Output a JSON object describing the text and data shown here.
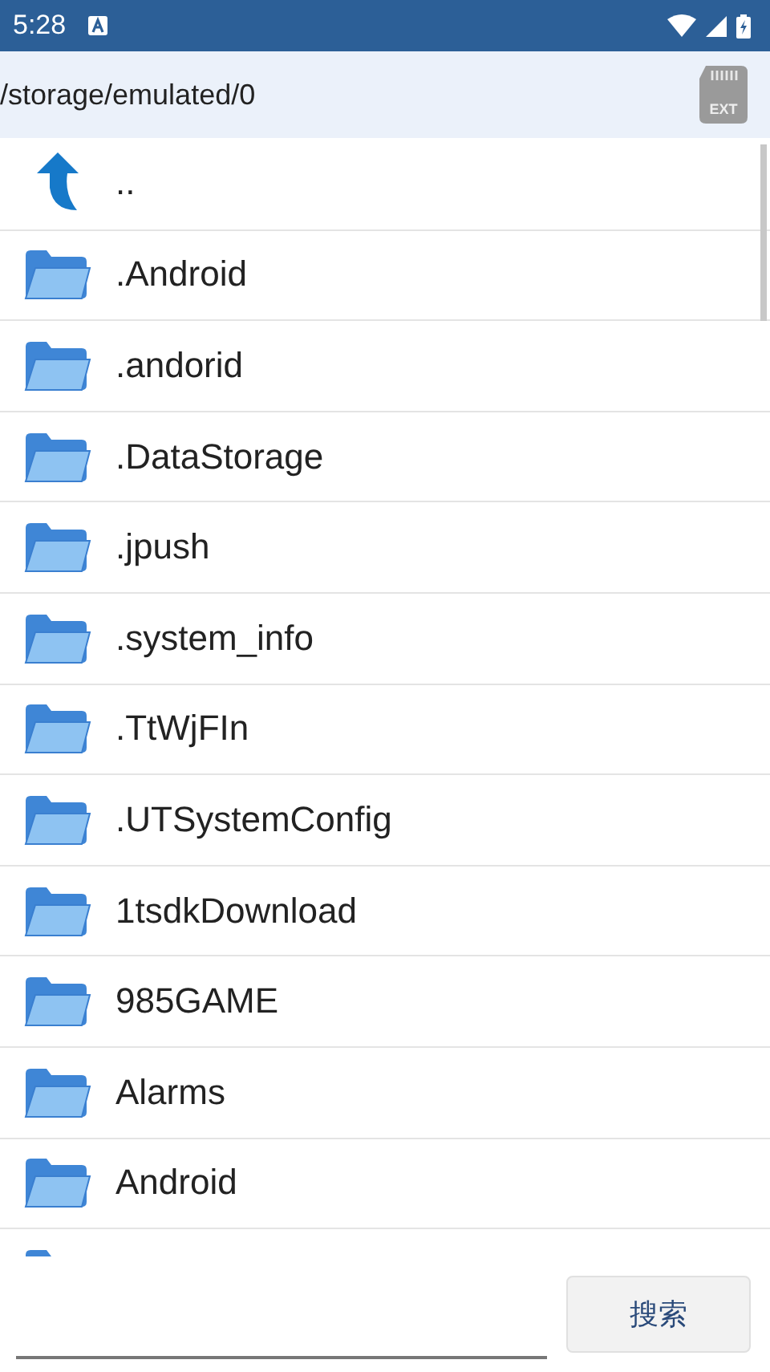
{
  "status_bar": {
    "time": "5:28"
  },
  "path_bar": {
    "path": "/storage/emulated/0",
    "storage_label": "EXT"
  },
  "files": [
    {
      "kind": "parent",
      "name": ".."
    },
    {
      "kind": "folder",
      "name": ".Android"
    },
    {
      "kind": "folder",
      "name": ".andorid"
    },
    {
      "kind": "folder",
      "name": ".DataStorage"
    },
    {
      "kind": "folder",
      "name": ".jpush"
    },
    {
      "kind": "folder",
      "name": ".system_info"
    },
    {
      "kind": "folder",
      "name": ".TtWjFIn"
    },
    {
      "kind": "folder",
      "name": ".UTSystemConfig"
    },
    {
      "kind": "folder",
      "name": "1tsdkDownload"
    },
    {
      "kind": "folder",
      "name": "985GAME"
    },
    {
      "kind": "folder",
      "name": "Alarms"
    },
    {
      "kind": "folder",
      "name": "Android"
    },
    {
      "kind": "folder"
    }
  ],
  "search": {
    "button": "搜索"
  }
}
